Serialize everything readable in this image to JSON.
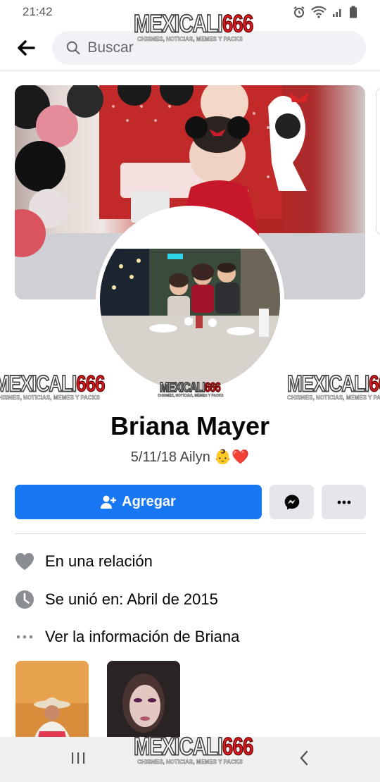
{
  "status": {
    "time": "21:42"
  },
  "search": {
    "placeholder": "Buscar"
  },
  "watermark": {
    "brand": "MEXICALI",
    "number": "666",
    "tagline": "CHISMES, NOTICIAS, MEMES Y PACKS"
  },
  "profile": {
    "name": "Briana Mayer",
    "bio_text": "5/11/18 Ailyn",
    "bio_emoji": "👶❤️"
  },
  "actions": {
    "add_label": "Agregar"
  },
  "info": [
    {
      "icon": "heart-icon",
      "text": "En una relación"
    },
    {
      "icon": "clock-icon",
      "text": "Se unió en: Abril de 2015"
    },
    {
      "icon": "ellipsis-icon",
      "text": "Ver la información de Briana"
    }
  ],
  "colors": {
    "primary": "#1877f2",
    "button_secondary": "#e4e6eb",
    "icon_gray": "#8a8d91"
  }
}
